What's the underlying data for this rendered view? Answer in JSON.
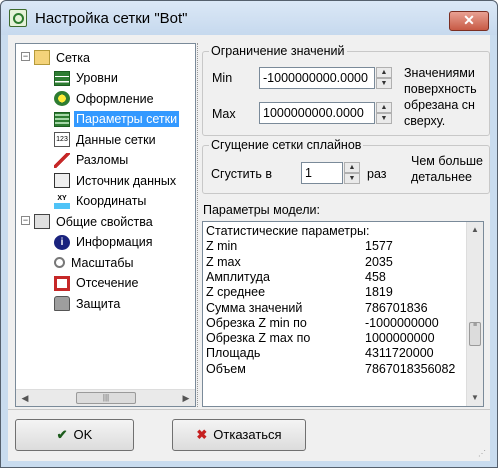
{
  "window": {
    "title": "Настройка сетки \"Bot\"",
    "close_glyph": "✕"
  },
  "tree": {
    "items": [
      {
        "label": "Сетка",
        "icon": "folder-icon",
        "expander": "−"
      },
      {
        "label": "Уровни",
        "icon": "levels-icon"
      },
      {
        "label": "Оформление",
        "icon": "appearance-icon"
      },
      {
        "label": "Параметры сетки",
        "icon": "grid-params-icon"
      },
      {
        "label": "Данные сетки",
        "icon": "grid-data-icon",
        "icon_text": "123"
      },
      {
        "label": "Разломы",
        "icon": "faults-icon"
      },
      {
        "label": "Источник данных",
        "icon": "data-source-icon"
      },
      {
        "label": "Координаты",
        "icon": "coordinates-icon",
        "icon_text": "XY"
      },
      {
        "label": "Общие свойства",
        "icon": "general-props-icon",
        "expander": "−"
      },
      {
        "label": "Информация",
        "icon": "info-icon",
        "icon_text": "i"
      },
      {
        "label": "Масштабы",
        "icon": "magnifier-icon"
      },
      {
        "label": "Отсечение",
        "icon": "clip-icon"
      },
      {
        "label": "Защита",
        "icon": "lock-icon"
      }
    ],
    "selected_index": 3
  },
  "limits": {
    "legend": "Ограничение значений",
    "min_label": "Min",
    "min_value": "-1000000000.0000",
    "max_label": "Max",
    "max_value": "1000000000.0000",
    "info_lines": [
      "Значениями",
      "поверхность",
      "обрезана сн",
      "сверху."
    ]
  },
  "spline": {
    "legend": "Сгущение сетки сплайнов",
    "label": "Сгустить в",
    "value": "1",
    "unit": "раз",
    "info_lines": [
      "Чем больше",
      "детальнее"
    ]
  },
  "params": {
    "label": "Параметры модели:",
    "lines": [
      {
        "name": "Статистические параметры:",
        "value": ""
      },
      {
        "name": "Z min",
        "value": "1577"
      },
      {
        "name": "Z max",
        "value": "2035"
      },
      {
        "name": "Амплитуда",
        "value": "458"
      },
      {
        "name": "Z среднее",
        "value": "1819"
      },
      {
        "name": "Сумма значений",
        "value": "786701836"
      },
      {
        "name": "Обрезка Z min по",
        "value": "-1000000000"
      },
      {
        "name": "Обрезка Z max по",
        "value": "1000000000"
      },
      {
        "name": "Площадь",
        "value": "4311720000"
      },
      {
        "name": "Объем",
        "value": "7867018356082"
      }
    ]
  },
  "buttons": {
    "ok": "OK",
    "cancel": "Отказаться"
  },
  "colors": {
    "selection": "#3399ff",
    "window_frame": "#c9dcef",
    "close": "#c75a45"
  }
}
